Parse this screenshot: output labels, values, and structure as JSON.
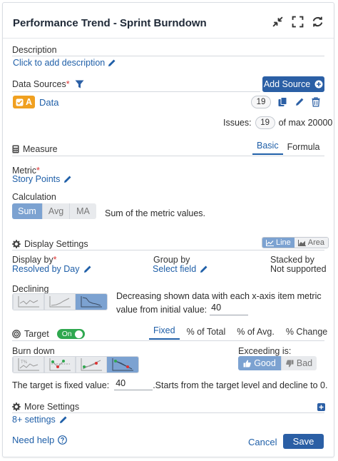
{
  "header": {
    "title": "Performance Trend - Sprint Burndown"
  },
  "description": {
    "label": "Description",
    "placeholder_link": "Click to add description"
  },
  "data_sources": {
    "label": "Data Sources",
    "required_mark": "*",
    "add_button": "Add Source",
    "source_badge": "A",
    "source_name": "Data",
    "source_count": "19",
    "issues_label": "Issues:",
    "issues_count": "19",
    "issues_max": "of max 20000"
  },
  "measure": {
    "label": "Measure",
    "tabs": [
      "Basic",
      "Formula"
    ],
    "metric_label": "Metric",
    "required_mark": "*",
    "metric_value": "Story Points",
    "calculation_label": "Calculation",
    "calc_options": [
      "Sum",
      "Avg",
      "MA"
    ],
    "calc_description": "Sum of the metric values."
  },
  "display": {
    "label": "Display Settings",
    "chart_types": [
      "Line",
      "Area"
    ],
    "display_by_label": "Display by",
    "required_mark": "*",
    "display_by_value": "Resolved by Day",
    "group_by_label": "Group by",
    "group_by_value": "Select field",
    "stacked_label": "Stacked by",
    "stacked_value": "Not supported",
    "declining_label": "Declining",
    "declining_desc_1": "Decreasing shown data with each x-axis item metric",
    "declining_desc_2": "value from initial value:",
    "declining_value": "40"
  },
  "target": {
    "label": "Target",
    "toggle": "On",
    "tabs": [
      "Fixed",
      "% of Total",
      "% of Avg.",
      "% Change"
    ],
    "burn_label": "Burn down",
    "exceeding_label": "Exceeding is:",
    "good": "Good",
    "bad": "Bad",
    "fixed_label": "The target is fixed value:",
    "fixed_value": "40",
    "fixed_suffix": ".Starts from the target level and decline to 0."
  },
  "more": {
    "label": "More Settings",
    "link": "8+ settings"
  },
  "footer": {
    "help": "Need help",
    "cancel": "Cancel",
    "save": "Save"
  },
  "colors": {
    "accent": "#2b5fa5",
    "link": "#1f5fa8",
    "selected": "#7ca2d1",
    "badge": "#f0a020",
    "toggle_on": "#2fa84f"
  }
}
